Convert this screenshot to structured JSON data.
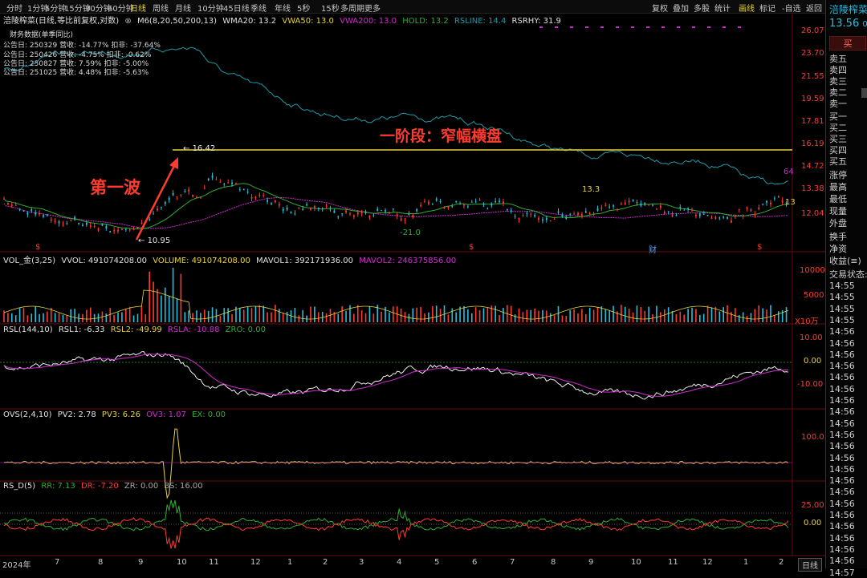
{
  "toolbar": {
    "periods": [
      "分时",
      "1分钟",
      "5分钟",
      "15分钟",
      "30分钟",
      "60分钟",
      "日线",
      "周线",
      "月线",
      "10分钟",
      "45日线",
      "季线",
      "年线",
      "5秒",
      "15秒",
      "多周期",
      "更多"
    ],
    "active_period": "日线",
    "right_menu": [
      "复权",
      "叠加",
      "多股",
      "统计",
      "画线",
      "标记",
      "-自选",
      "返回"
    ],
    "active_right": "画线"
  },
  "stock": {
    "name": "涪陵榨菜",
    "chart_title": "涪陵榨菜(日线,等比前复权,对数)",
    "price": "13.56",
    "price_suffix": "0",
    "buy_button": "买"
  },
  "main_legend": {
    "ma": "M6(8,20,50,200,13)",
    "wma20": "WMA20: 13.2",
    "vwa50": "VWA50: 13.0",
    "vwa200": "VWA200: 13.0",
    "hold": "HOLD: 13.2",
    "rsline": "RSLINE: 14.4",
    "rsrhy": "RSRHY: 31.9"
  },
  "financial": {
    "title": "财务数据(单季同比)",
    "rows": [
      "公告日: 250329   营收: -14.77%   扣非: -37.64%",
      "公告日: 250426   营收: -4.75%   扣非: -0.62%",
      "公告日: 250827   营收: 7.59%   扣非: -5.00%",
      "公告日: 251025   营收: 4.48%   扣非: -5.63%"
    ]
  },
  "annotations": {
    "wave": "第一波",
    "stage": "一阶段：窄幅横盘",
    "high_label": "16.42",
    "low_label": "10.95",
    "label_13_3": "13.3",
    "label_neg21": "-21.0",
    "label_64": "64",
    "label_13": "13",
    "cai": "财",
    "dollar": "$"
  },
  "price_axis": [
    "26.07",
    "23.70",
    "21.55",
    "19.59",
    "17.81",
    "16.19",
    "14.72",
    "13.38",
    "12.04"
  ],
  "vol_panel": {
    "legend": [
      "VOL_金(3,25)",
      "VVOL: 491074208.00",
      "VOLUME: 491074208.00",
      "MAVOL1: 392171936.00",
      "MAVOL2: 246375856.00"
    ],
    "axis": [
      "10000",
      "5000",
      "X10万"
    ]
  },
  "rsl_panel": {
    "legend": [
      "RSL(144,10)",
      "RSL1: -6.33",
      "RSL2: -49.99",
      "RSLA: -10.88",
      "ZRO: 0.00"
    ],
    "axis": [
      "10.00",
      "0.00",
      "-10.00"
    ]
  },
  "ovs_panel": {
    "legend": [
      "OVS(2,4,10)",
      "PV2: 2.78",
      "PV3: 6.26",
      "OV3: 1.07",
      "EX: 0.00"
    ],
    "axis": [
      "100.0"
    ]
  },
  "rsd_panel": {
    "legend": [
      "RS_D(5)",
      "RR: 7.13",
      "DR: -7.20",
      "ZR: 0.00",
      "BS: 16.00"
    ],
    "axis": [
      "25.00",
      "0.00"
    ]
  },
  "x_axis": [
    "2024年",
    "7",
    "8",
    "9",
    "10",
    "11",
    "12",
    "1",
    "2",
    "3",
    "4",
    "5",
    "6",
    "7",
    "8",
    "9",
    "10",
    "11",
    "12",
    "1",
    "2"
  ],
  "x_axis_button": "日线",
  "side_panel": {
    "sell": [
      "卖五",
      "卖四",
      "卖三",
      "卖二",
      "卖一"
    ],
    "buy": [
      "买一",
      "买二",
      "买三",
      "买四",
      "买五"
    ],
    "stats": [
      "涨停",
      "最高",
      "最低",
      "现量",
      "外盘"
    ],
    "extra": [
      "换手",
      "净资",
      "收益(≡)"
    ],
    "trade_state": "交易状态:",
    "times": [
      "14:55",
      "14:55",
      "14:55",
      "14:55",
      "14:56",
      "14:56",
      "14:56",
      "14:56",
      "14:56",
      "14:56",
      "14:56",
      "14:56",
      "14:56",
      "14:56",
      "14:56",
      "14:56",
      "14:56",
      "14:56",
      "14:56",
      "14:56",
      "14:56",
      "14:56",
      "14:56",
      "14:56",
      "14:56",
      "14:57"
    ]
  },
  "colors": {
    "price_line": "#1e9aa8",
    "yellow": "#e6d23c",
    "magenta": "#d22ad2",
    "green": "#2fae2f",
    "red": "#ff3b30",
    "annotation": "#ff3b30",
    "up": "#ff3b30",
    "down": "#26c0e0"
  }
}
